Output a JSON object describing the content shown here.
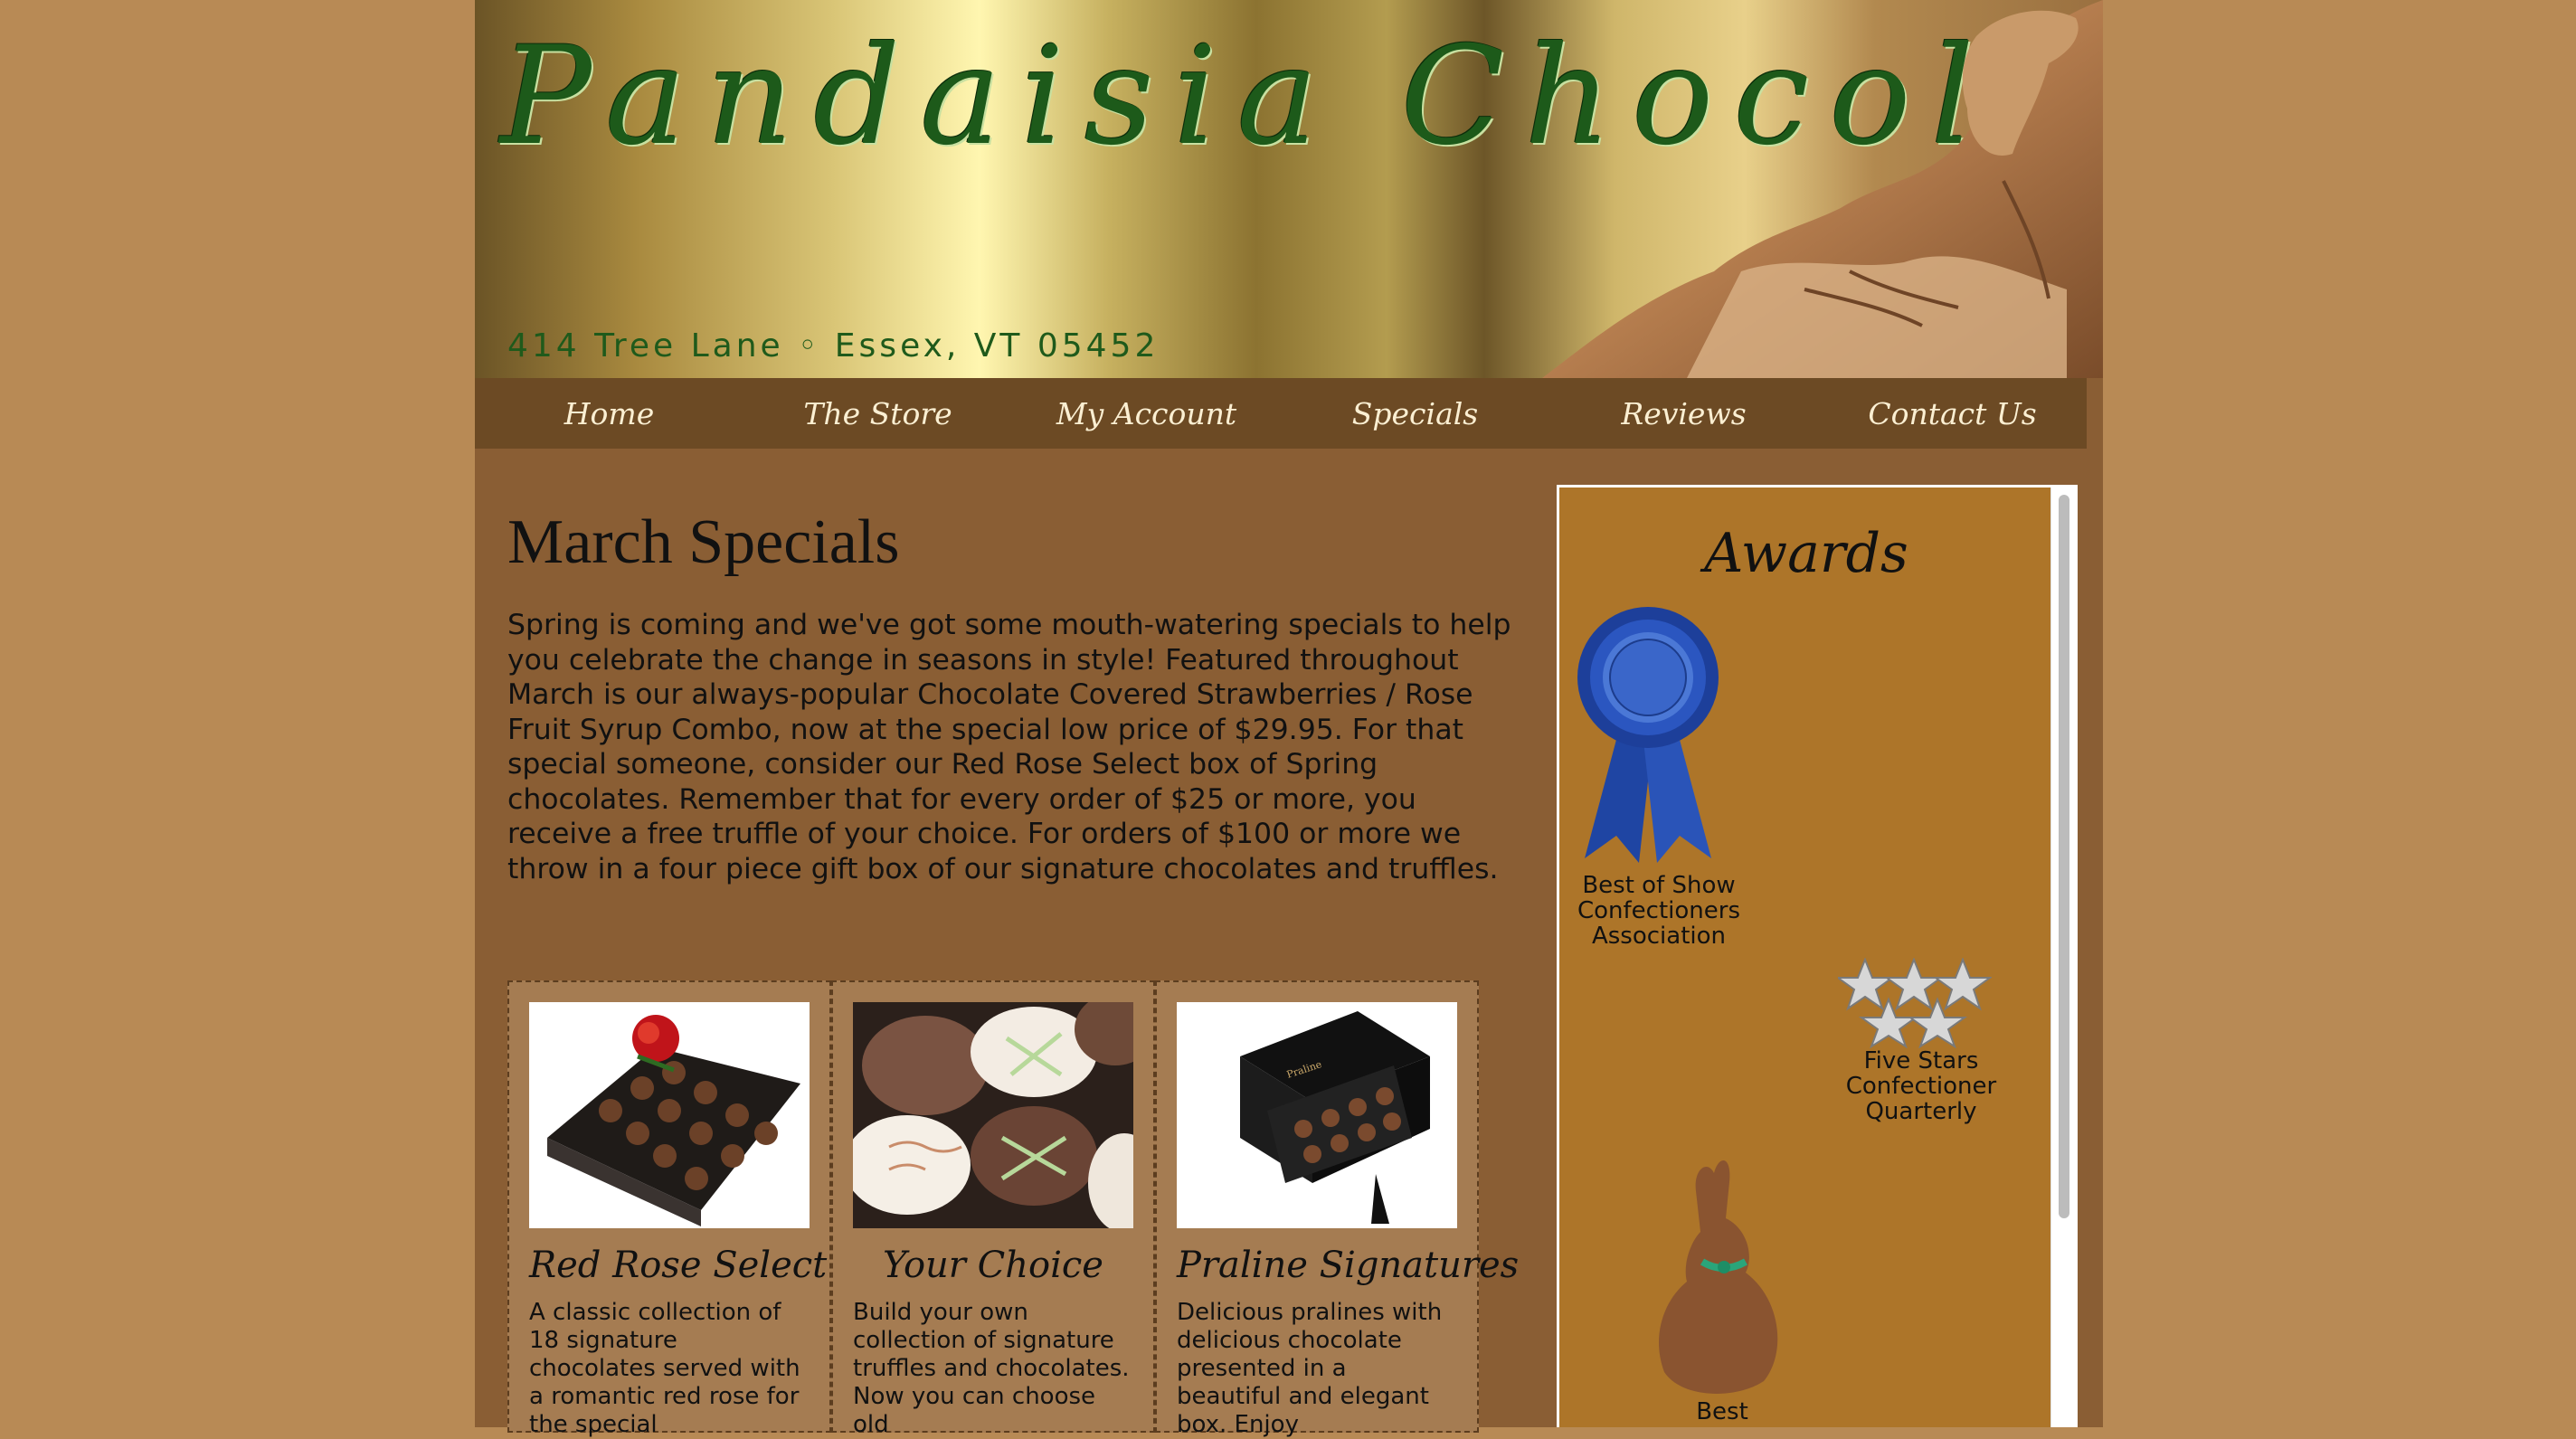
{
  "header": {
    "brand": "Pandaisia Chocolates",
    "address": "414 Tree Lane ◦ Essex, VT 05452"
  },
  "nav": {
    "items": [
      {
        "label": "Home"
      },
      {
        "label": "The Store"
      },
      {
        "label": "My Account"
      },
      {
        "label": "Specials"
      },
      {
        "label": "Reviews"
      },
      {
        "label": "Contact Us"
      }
    ]
  },
  "main": {
    "title": "March Specials",
    "intro": "Spring is coming and we've got some mouth-watering specials to help you celebrate the change in seasons in style! Featured throughout March is our always-popular Chocolate Covered Strawberries / Rose Fruit Syrup Combo, now at the special low price of $29.95. For that special someone, consider our Red Rose Select box of Spring chocolates. Remember that for every order of $25 or more, you receive a free truffle of your choice. For orders of $100 or more we throw in a four piece gift box of our signature chocolates and truffles."
  },
  "products": [
    {
      "name": "Red Rose Select",
      "desc": "A classic collection of 18 signature chocolates served with a romantic red rose for the special"
    },
    {
      "name": "Your Choice",
      "desc": "Build your own collection of signature truffles and chocolates. Now you can choose old"
    },
    {
      "name": "Praline Signatures",
      "desc": "Delicious pralines with delicious chocolate presented in a beautiful and elegant box. Enjoy"
    }
  ],
  "sidebar": {
    "title": "Awards",
    "awards": [
      {
        "caption": "Best of Show Confectioners Association",
        "icon": "ribbon-icon"
      },
      {
        "caption": "Five Stars Confectioner Quarterly",
        "icon": "stars-icon"
      },
      {
        "caption": "Best",
        "icon": "chocolate-bunny-icon"
      }
    ]
  }
}
